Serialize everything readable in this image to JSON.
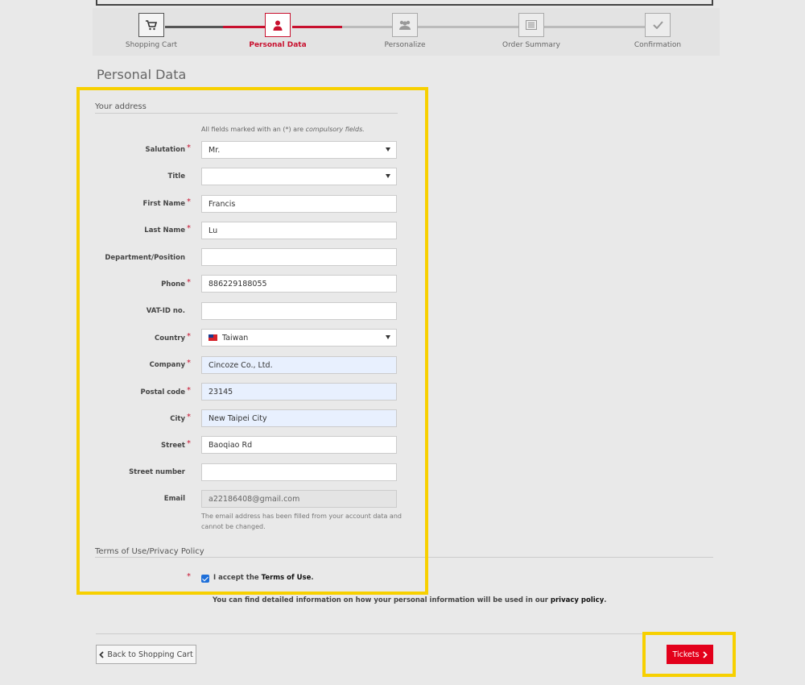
{
  "steps": [
    {
      "label": "Shopping Cart",
      "icon": "cart-icon"
    },
    {
      "label": "Personal Data",
      "icon": "person-icon"
    },
    {
      "label": "Personalize",
      "icon": "group-icon"
    },
    {
      "label": "Order Summary",
      "icon": "list-icon"
    },
    {
      "label": "Confirmation",
      "icon": "check-icon"
    }
  ],
  "page_title": "Personal Data",
  "address_section": "Your address",
  "compulsory_note": {
    "prefix": "All fields marked with an (*) are ",
    "emph": "compulsory fields."
  },
  "fields": {
    "salutation": {
      "label": "Salutation",
      "value": "Mr.",
      "required": "*"
    },
    "title": {
      "label": "Title",
      "value": ""
    },
    "first_name": {
      "label": "First Name",
      "value": "Francis",
      "required": "*"
    },
    "last_name": {
      "label": "Last Name",
      "value": "Lu",
      "required": "*"
    },
    "department": {
      "label": "Department/Position",
      "value": ""
    },
    "phone": {
      "label": "Phone",
      "value": "886229188055",
      "required": "*"
    },
    "vat": {
      "label": "VAT-ID no.",
      "value": ""
    },
    "country": {
      "label": "Country",
      "value": "Taiwan",
      "required": "*"
    },
    "company": {
      "label": "Company",
      "value": "Cincoze Co., Ltd.",
      "required": "*"
    },
    "postal": {
      "label": "Postal code",
      "value": "23145",
      "required": "*"
    },
    "city": {
      "label": "City",
      "value": "New Taipei City",
      "required": "*"
    },
    "street": {
      "label": "Street",
      "value": "Baoqiao Rd",
      "required": "*"
    },
    "street_number": {
      "label": "Street number",
      "value": ""
    },
    "email": {
      "label": "Email",
      "value": "a22186408@gmail.com"
    }
  },
  "email_help": "The email address has been filled from your account data and cannot be changed.",
  "terms_section": "Terms of Use/Privacy Policy",
  "terms": {
    "prefix": "I accept the ",
    "link": "Terms of Use",
    "suffix": ".",
    "required": "*"
  },
  "privacy": {
    "prefix": "You can find detailed information on how your personal information will be used in our ",
    "link": "privacy policy",
    "suffix": "."
  },
  "buttons": {
    "back": "Back to Shopping Cart",
    "tickets": "Tickets"
  },
  "colors": {
    "accent": "#e3001b",
    "highlight": "#f7d000",
    "autofill": "#e8f0fe"
  }
}
